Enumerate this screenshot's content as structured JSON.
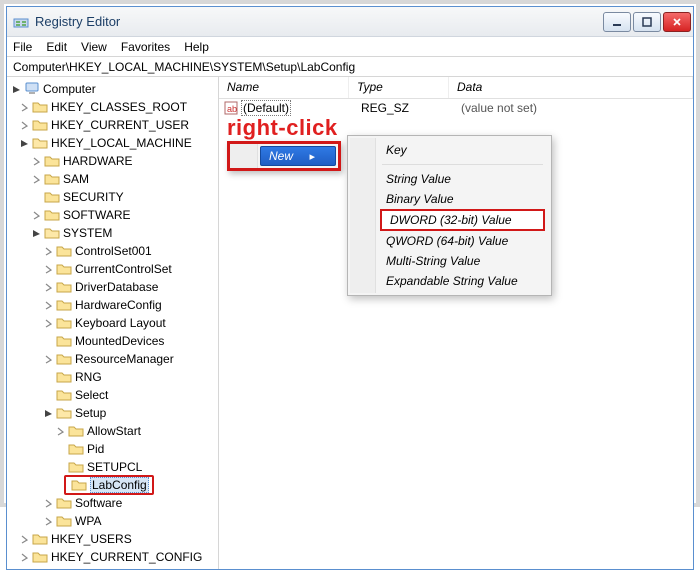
{
  "title": "Registry Editor",
  "menus": [
    "File",
    "Edit",
    "View",
    "Favorites",
    "Help"
  ],
  "address": "Computer\\HKEY_LOCAL_MACHINE\\SYSTEM\\Setup\\LabConfig",
  "annot": "right-click",
  "list_cols": {
    "name": "Name",
    "type": "Type",
    "data": "Data"
  },
  "value_row": {
    "name": "(Default)",
    "type": "REG_SZ",
    "data": "(value not set)"
  },
  "ctx_new": "New",
  "submenu": {
    "key": "Key",
    "string": "String Value",
    "binary": "Binary Value",
    "dword": "DWORD (32-bit) Value",
    "qword": "QWORD (64-bit) Value",
    "multi": "Multi-String Value",
    "expand": "Expandable String Value"
  },
  "tree_root": "Computer",
  "tree": {
    "hkcr": "HKEY_CLASSES_ROOT",
    "hkcu": "HKEY_CURRENT_USER",
    "hklm": "HKEY_LOCAL_MACHINE",
    "hardware": "HARDWARE",
    "sam": "SAM",
    "security": "SECURITY",
    "software": "SOFTWARE",
    "system": "SYSTEM",
    "cs001": "ControlSet001",
    "ccs": "CurrentControlSet",
    "drvdb": "DriverDatabase",
    "hwcfg": "HardwareConfig",
    "kblayout": "Keyboard Layout",
    "mdev": "MountedDevices",
    "resmgr": "ResourceManager",
    "rng": "RNG",
    "select": "Select",
    "setup": "Setup",
    "allowstart": "AllowStart",
    "pid": "Pid",
    "setupcl": "SETUPCL",
    "labconfig": "LabConfig",
    "software2": "Software",
    "wpa": "WPA",
    "hku": "HKEY_USERS",
    "hkcc_trunc": "HKEY_CURRENT_CONFIG"
  }
}
